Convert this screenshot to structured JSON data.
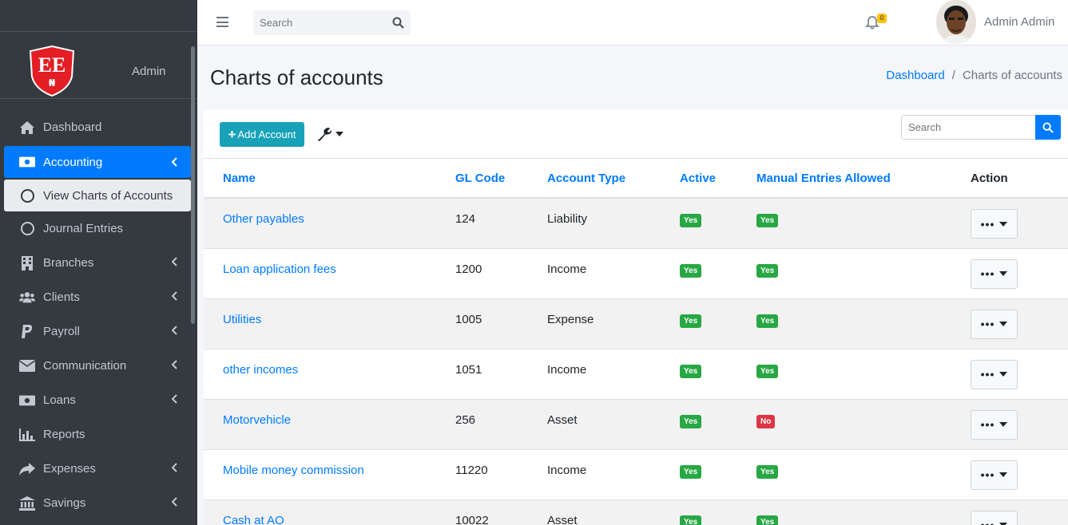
{
  "sidebar": {
    "brand_user": "Admin",
    "logo_text": "EE",
    "logo_sub": "₦",
    "items": [
      {
        "label": "Dashboard",
        "icon": "home-icon"
      },
      {
        "label": "Accounting",
        "icon": "money-icon"
      },
      {
        "label": "View Charts of Accounts",
        "icon": "circle-icon"
      },
      {
        "label": "Journal Entries",
        "icon": "circle-icon"
      },
      {
        "label": "Branches",
        "icon": "building-icon"
      },
      {
        "label": "Clients",
        "icon": "users-icon"
      },
      {
        "label": "Payroll",
        "icon": "paypal-icon"
      },
      {
        "label": "Communication",
        "icon": "envelope-icon"
      },
      {
        "label": "Loans",
        "icon": "money-icon"
      },
      {
        "label": "Reports",
        "icon": "bar-chart-icon"
      },
      {
        "label": "Expenses",
        "icon": "share-icon"
      },
      {
        "label": "Savings",
        "icon": "bank-icon"
      }
    ]
  },
  "navbar": {
    "search_placeholder": "Search",
    "notification_count": "0",
    "user_name": "Admin Admin"
  },
  "header": {
    "title": "Charts of accounts",
    "breadcrumb": [
      "Dashboard",
      "Charts of accounts"
    ]
  },
  "toolbar": {
    "add_label": "Add Account",
    "search_placeholder": "Search"
  },
  "table": {
    "columns": [
      "Name",
      "GL Code",
      "Account Type",
      "Active",
      "Manual Entries Allowed",
      "Action"
    ],
    "rows": [
      {
        "name": "Other payables",
        "gl": "124",
        "type": "Liability",
        "active": "Yes",
        "manual": "Yes"
      },
      {
        "name": "Loan application fees",
        "gl": "1200",
        "type": "Income",
        "active": "Yes",
        "manual": "Yes"
      },
      {
        "name": "Utilities",
        "gl": "1005",
        "type": "Expense",
        "active": "Yes",
        "manual": "Yes"
      },
      {
        "name": "other incomes",
        "gl": "1051",
        "type": "Income",
        "active": "Yes",
        "manual": "Yes"
      },
      {
        "name": "Motorvehicle",
        "gl": "256",
        "type": "Asset",
        "active": "Yes",
        "manual": "No"
      },
      {
        "name": "Mobile money commission",
        "gl": "11220",
        "type": "Income",
        "active": "Yes",
        "manual": "Yes"
      },
      {
        "name": "Cash at AO",
        "gl": "10022",
        "type": "Asset",
        "active": "Yes",
        "manual": "Yes"
      }
    ]
  },
  "colors": {
    "sidebar_bg": "#343a40",
    "primary": "#007bff",
    "info": "#17a2b8",
    "success": "#28a745",
    "danger": "#dc3545"
  }
}
